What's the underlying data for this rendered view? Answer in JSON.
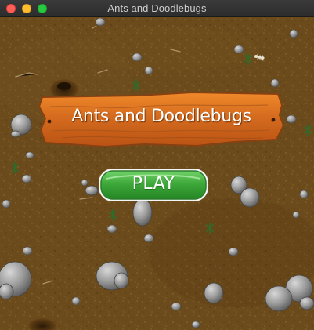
{
  "window": {
    "title": "Ants and Doodlebugs"
  },
  "game": {
    "banner_title": "Ants and Doodlebugs",
    "play_label": "PLAY"
  },
  "colors": {
    "dirt": "#6a4c1c",
    "wood": "#d9691e",
    "play_green": "#3fae3f",
    "rock": "#8e8e8e"
  },
  "icons": {
    "close": "close-button",
    "minimize": "minimize-button",
    "zoom": "zoom-button",
    "ant": "ant-icon",
    "doodlebug": "doodlebug-icon",
    "rock": "rock-icon",
    "weed": "weed-icon"
  }
}
